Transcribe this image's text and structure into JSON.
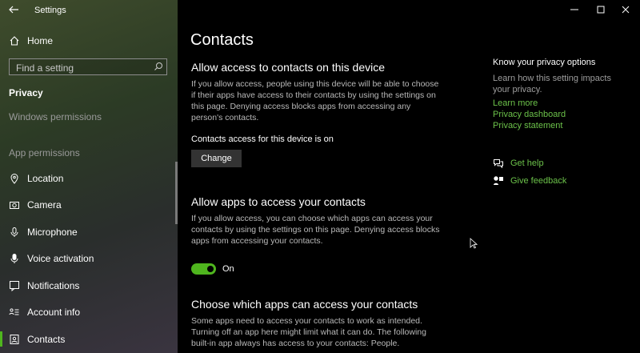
{
  "window": {
    "title": "Settings"
  },
  "sidebar": {
    "home": "Home",
    "search_placeholder": "Find a setting",
    "section": "Privacy",
    "windows_permissions": "Windows permissions",
    "app_permissions": "App permissions",
    "items": [
      {
        "label": "Location",
        "icon": "location-icon"
      },
      {
        "label": "Camera",
        "icon": "camera-icon"
      },
      {
        "label": "Microphone",
        "icon": "microphone-icon"
      },
      {
        "label": "Voice activation",
        "icon": "voice-activation-icon"
      },
      {
        "label": "Notifications",
        "icon": "notifications-icon"
      },
      {
        "label": "Account info",
        "icon": "account-info-icon"
      },
      {
        "label": "Contacts",
        "icon": "contacts-icon"
      }
    ]
  },
  "main": {
    "title": "Contacts",
    "device_heading": "Allow access to contacts on this device",
    "device_desc": "If you allow access, people using this device will be able to choose if their apps have access to their contacts by using the settings on this page. Denying access blocks apps from accessing any person's contacts.",
    "device_status": "Contacts access for this device is on",
    "change_button": "Change",
    "apps_heading": "Allow apps to access your contacts",
    "apps_desc": "If you allow access, you can choose which apps can access your contacts by using the settings on this page. Denying access blocks apps from accessing your contacts.",
    "toggle_label": "On",
    "toggle_on": true,
    "choose_heading": "Choose which apps can access your contacts",
    "choose_desc": "Some apps need to access your contacts to work as intended. Turning off an app here might limit what it can do. The following built-in app always has access to your contacts: People."
  },
  "right": {
    "heading": "Know your privacy options",
    "desc": "Learn how this setting impacts your privacy.",
    "learn_more": "Learn more",
    "privacy_dashboard": "Privacy dashboard",
    "privacy_statement": "Privacy statement",
    "get_help": "Get help",
    "give_feedback": "Give feedback"
  },
  "colors": {
    "accent": "#4fb51e",
    "link": "#6cc24a",
    "text_secondary": "#b9b9b9"
  }
}
